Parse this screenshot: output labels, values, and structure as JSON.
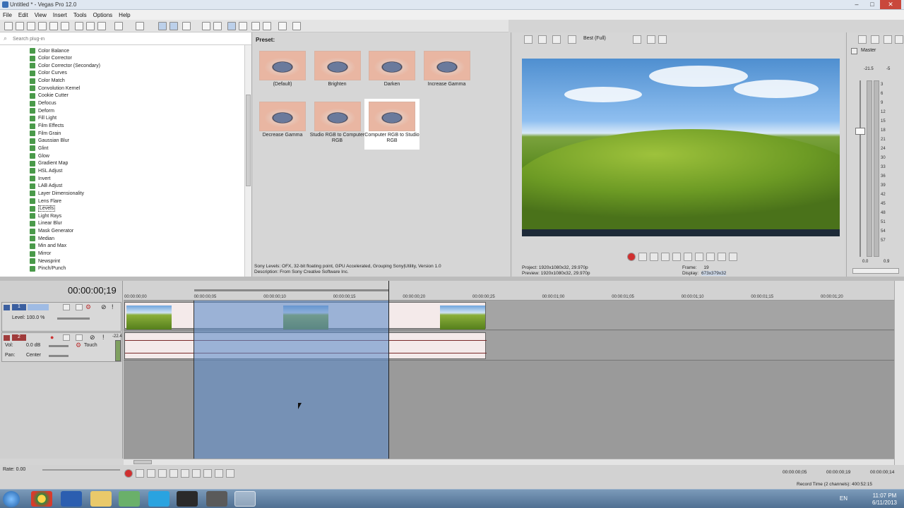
{
  "window": {
    "title": "Untitled * - Vegas Pro 12.0",
    "min": "–",
    "max": "□",
    "close": "✕"
  },
  "menu": [
    "File",
    "Edit",
    "View",
    "Insert",
    "Tools",
    "Options",
    "Help"
  ],
  "plugins": {
    "search_placeholder": "Search plug-in",
    "items": [
      "Color Balance",
      "Color Corrector",
      "Color Corrector (Secondary)",
      "Color Curves",
      "Color Match",
      "Convolution Kernel",
      "Cookie Cutter",
      "Defocus",
      "Deform",
      "Fill Light",
      "Film Effects",
      "Film Grain",
      "Gaussian Blur",
      "Glint",
      "Glow",
      "Gradient Map",
      "HSL Adjust",
      "Invert",
      "LAB Adjust",
      "Layer Dimensionality",
      "Lens Flare",
      "Levels",
      "Light Rays",
      "Linear Blur",
      "Mask Generator",
      "Median",
      "Min and Max",
      "Mirror",
      "Newsprint",
      "Pinch/Punch"
    ],
    "selected": "Levels"
  },
  "presets": {
    "header": "Preset:",
    "items": [
      "(Default)",
      "Brighten",
      "Darken",
      "Increase Gamma",
      "Decrease Gamma",
      "Studio RGB to Computer RGB",
      "Computer RGB to Studio RGB"
    ],
    "selected": "Computer RGB to Studio RGB"
  },
  "plugin_info": {
    "line1": "Sony Levels: OFX, 32-bit floating point, GPU Accelerated, Grouping Sony|Utility, Version 1.0",
    "line2": "Description: From Sony Creative Software Inc."
  },
  "preview": {
    "quality": "Best (Full)",
    "project_label": "Project:",
    "project_value": "1920x1080x32, 29.970p",
    "preview_label": "Preview:",
    "preview_value": "1920x1080x32, 29.970p",
    "frame_label": "Frame:",
    "frame_value": "19",
    "display_label": "Display:",
    "display_value": "673x379x32"
  },
  "master": {
    "label": "Master",
    "peak_left": "-21.5",
    "peak_right": "-5",
    "scale": [
      "3",
      "6",
      "9",
      "12",
      "15",
      "18",
      "21",
      "24",
      "30",
      "33",
      "36",
      "39",
      "42",
      "45",
      "48",
      "51",
      "54",
      "57"
    ],
    "val_left": "0.0",
    "val_right": "0.9"
  },
  "timeline": {
    "timecode": "00:00:00;19",
    "ruler": [
      "00:00:00;00",
      "00:00:00;05",
      "00:00:00;10",
      "00:00:00;15",
      "00:00:00;20",
      "00:00:00;25",
      "00:00:01;00",
      "00:00:01;05",
      "00:00:01;10",
      "00:00:01;15",
      "00:00:01;20"
    ]
  },
  "video_track": {
    "number": "1",
    "level": "Level: 100.0 %"
  },
  "audio_track": {
    "number": "2",
    "vol": "Vol:",
    "vol_value": "0.0 dB",
    "touch": "Touch",
    "pan": "Pan:",
    "pan_value": "Center",
    "meter_top": "-22.4"
  },
  "bottom": {
    "rate": "Rate: 0.00",
    "tc1": "00:00:00;05",
    "tc2": "00:00:00;19",
    "tc3": "00:00:00;14",
    "record_time": "Record Time (2 channels): 400:52:15"
  },
  "taskbar": {
    "lang": "EN",
    "time": "11:07 PM",
    "date": "6/11/2013"
  }
}
